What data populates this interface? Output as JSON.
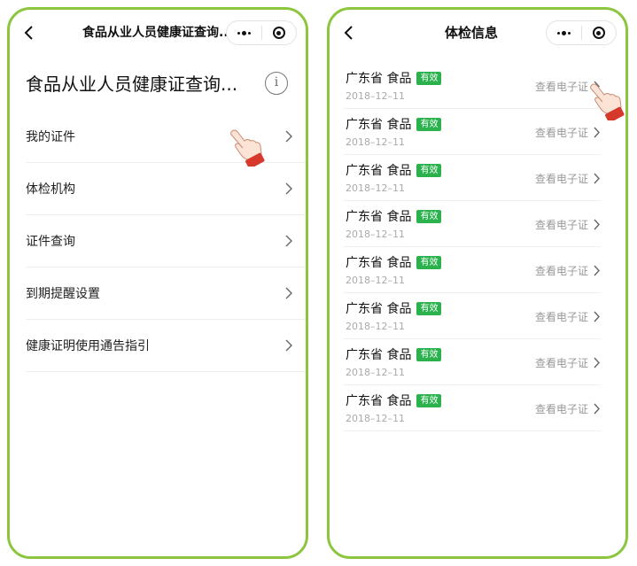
{
  "left_phone": {
    "nav_title": "食品从业人员健康证查询...",
    "page_heading": "食品从业人员健康证查询...",
    "info_glyph": "i",
    "menu_items": [
      {
        "label": "我的证件"
      },
      {
        "label": "体检机构"
      },
      {
        "label": "证件查询"
      },
      {
        "label": "到期提醒设置"
      },
      {
        "label": "健康证明使用通告指引"
      }
    ]
  },
  "right_phone": {
    "nav_title": "体检信息",
    "records": [
      {
        "title": "广东省 食品",
        "badge": "有效",
        "date": "2018–12–11",
        "link": "查看电子证"
      },
      {
        "title": "广东省 食品",
        "badge": "有效",
        "date": "2018–12–11",
        "link": "查看电子证"
      },
      {
        "title": "广东省 食品",
        "badge": "有效",
        "date": "2018–12–11",
        "link": "查看电子证"
      },
      {
        "title": "广东省 食品",
        "badge": "有效",
        "date": "2018–12–11",
        "link": "查看电子证"
      },
      {
        "title": "广东省 食品",
        "badge": "有效",
        "date": "2018–12–11",
        "link": "查看电子证"
      },
      {
        "title": "广东省 食品",
        "badge": "有效",
        "date": "2018–12–11",
        "link": "查看电子证"
      },
      {
        "title": "广东省 食品",
        "badge": "有效",
        "date": "2018–12–11",
        "link": "查看电子证"
      },
      {
        "title": "广东省 食品",
        "badge": "有效",
        "date": "2018–12–11",
        "link": "查看电子证"
      }
    ]
  },
  "icons": {
    "back": "back-arrow-icon",
    "more": "more-dots-icon",
    "home": "target-circle-icon",
    "chevron": "chevron-right-icon",
    "pointer": "pointing-hand-icon"
  },
  "colors": {
    "phone_border": "#8cc63f",
    "badge_green": "#2bb24c",
    "cuff_red": "#d6392c",
    "muted_text": "#999999"
  }
}
